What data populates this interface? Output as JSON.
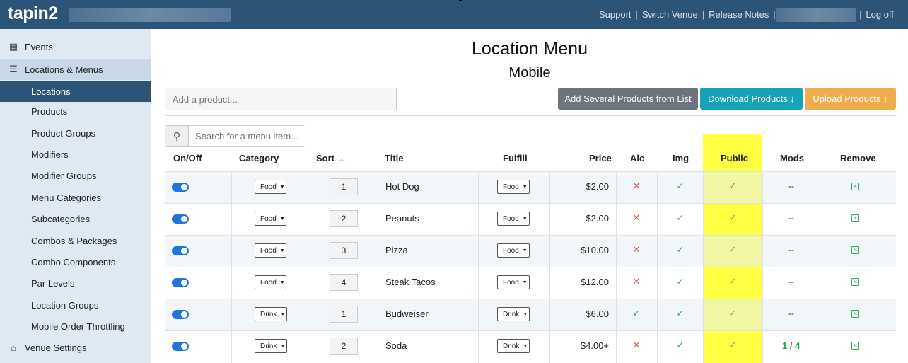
{
  "header": {
    "logo": "tapin2",
    "links": [
      "Support",
      "Switch Venue",
      "Release Notes",
      "Log off"
    ]
  },
  "sidebar": {
    "events": "Events",
    "locations_menus": "Locations & Menus",
    "items": [
      "Locations",
      "Products",
      "Product Groups",
      "Modifiers",
      "Modifier Groups",
      "Menu Categories",
      "Subcategories",
      "Combos & Packages",
      "Combo Components",
      "Par Levels",
      "Location Groups",
      "Mobile Order Throttling"
    ],
    "venue_settings": "Venue Settings",
    "icons": [
      "calendar-icon",
      "list-icon",
      "home-icon"
    ]
  },
  "main": {
    "title": "Location Menu",
    "subtitle": "Mobile",
    "add_product_placeholder": "Add a product...",
    "buttons": {
      "add_several": "Add Several Products from List",
      "download": "Download Products ↓",
      "upload": "Upload Products ↑"
    },
    "search_placeholder": "Search for a menu item...",
    "columns": [
      "On/Off",
      "Category",
      "Sort",
      "Title",
      "Fulfill",
      "Price",
      "Alc",
      "Img",
      "Public",
      "Mods",
      "Remove"
    ],
    "highlight_color": "#ffff44",
    "rows": [
      {
        "category": "Food",
        "sort": "1",
        "title": "Hot Dog",
        "fulfill": "Food",
        "price": "$2.00",
        "alc": "x",
        "mods": "--"
      },
      {
        "category": "Food",
        "sort": "2",
        "title": "Peanuts",
        "fulfill": "Food",
        "price": "$2.00",
        "alc": "x",
        "mods": "--"
      },
      {
        "category": "Food",
        "sort": "3",
        "title": "Pizza",
        "fulfill": "Food",
        "price": "$10.00",
        "alc": "x",
        "mods": "--"
      },
      {
        "category": "Food",
        "sort": "4",
        "title": "Steak Tacos",
        "fulfill": "Food",
        "price": "$12.00",
        "alc": "x",
        "mods": "--"
      },
      {
        "category": "Drink",
        "sort": "1",
        "title": "Budweiser",
        "fulfill": "Drink",
        "price": "$6.00",
        "alc": "check",
        "mods": "--"
      },
      {
        "category": "Drink",
        "sort": "2",
        "title": "Soda",
        "fulfill": "Drink",
        "price": "$4.00+",
        "alc": "x",
        "mods": "1 / 4"
      }
    ]
  }
}
